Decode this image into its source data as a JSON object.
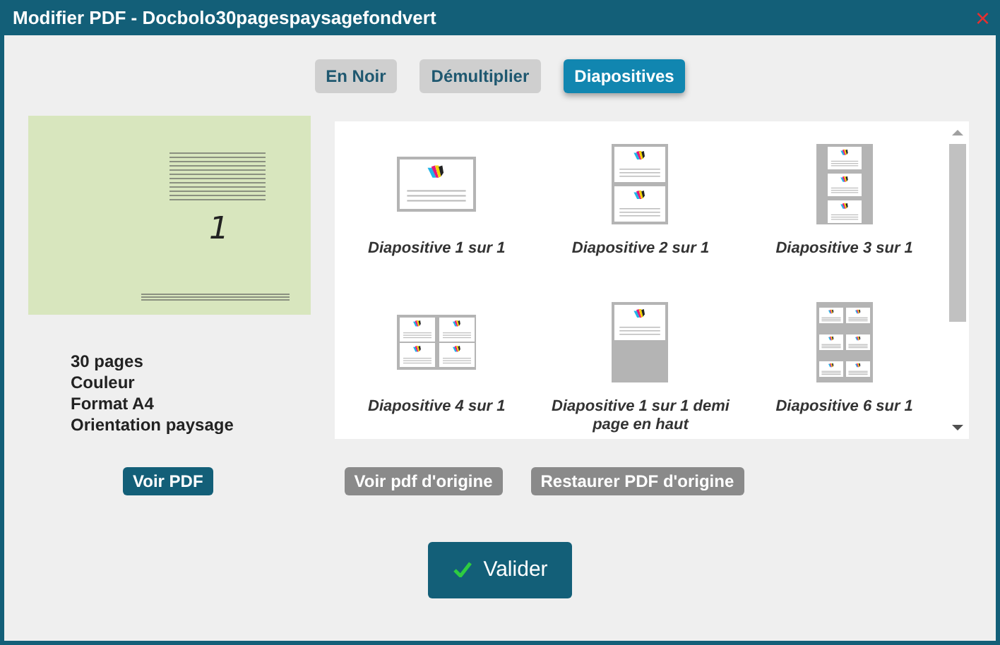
{
  "window": {
    "title": "Modifier PDF - Docbolo30pagespaysagefondvert",
    "close": "×"
  },
  "tabs": [
    {
      "label": "En Noir",
      "selected": false
    },
    {
      "label": "Démultiplier",
      "selected": false
    },
    {
      "label": "Diapositives",
      "selected": true
    }
  ],
  "preview": {
    "page_number": "1"
  },
  "info": [
    "30 pages",
    "Couleur",
    "Format A4",
    "Orientation paysage"
  ],
  "slides": [
    {
      "kind": "one",
      "label": "Diapositive 1 sur 1"
    },
    {
      "kind": "two",
      "label": "Diapositive 2 sur 1"
    },
    {
      "kind": "three",
      "label": "Diapositive 3 sur 1"
    },
    {
      "kind": "four",
      "label": "Diapositive 4 sur 1"
    },
    {
      "kind": "half",
      "label": "Diapositive 1 sur 1 demi page en haut"
    },
    {
      "kind": "six",
      "label": "Diapositive 6 sur 1"
    }
  ],
  "actions": [
    {
      "label": "Voir PDF",
      "kind": "primary"
    },
    {
      "label": "Voir pdf d'origine",
      "kind": "secondary"
    },
    {
      "label": "Restaurer PDF d'origine",
      "kind": "secondary"
    }
  ],
  "validate": {
    "label": "Valider"
  }
}
